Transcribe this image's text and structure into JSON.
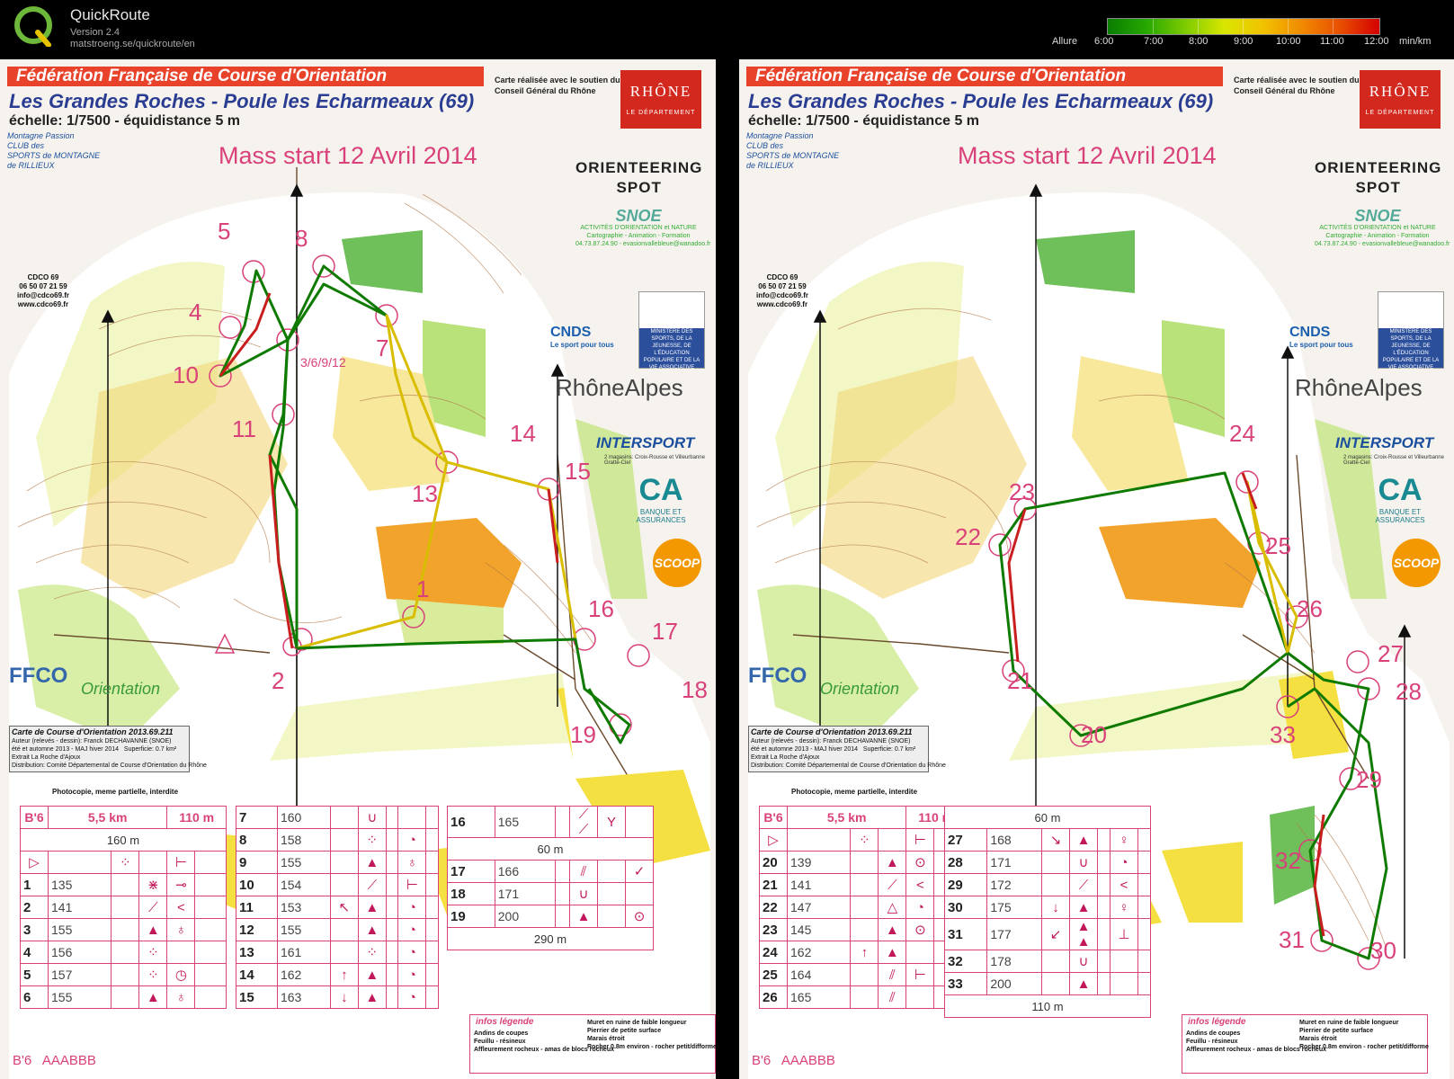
{
  "app": {
    "name": "QuickRoute",
    "version": "Version 2.4",
    "url": "matstroeng.se/quickroute/en"
  },
  "pace_scale": {
    "label": "Allure",
    "ticks": [
      "6:00",
      "7:00",
      "8:00",
      "9:00",
      "10:00",
      "11:00",
      "12:00"
    ],
    "unit": "min/km",
    "colors": [
      "#0a7d00",
      "#27a800",
      "#7ecb00",
      "#d8e600",
      "#f2c200",
      "#f08a00",
      "#e84e00",
      "#d40000"
    ]
  },
  "map": {
    "federation": "Fédération Française de Course d'Orientation",
    "title": "Les Grandes Roches - Poule les Echarmeaux (69)",
    "scale_line": "échelle: 1/7500  - équidistance 5 m",
    "event": "Mass start 12 Avril 2014",
    "support_note": "Carte réalisée avec le soutien du Conseil Général du Rhône",
    "rhone_logo": "RHÔNE",
    "rhone_sub": "LE DÉPARTEMENT",
    "club": "Montagne Passion\nCLUB des\nSPORTS de MONTAGNE\nde RILLIEUX",
    "cdco": "CDCO 69\n06 50 07 21 59\ninfo@cdco69.fr\nwww.cdco69.fr",
    "orienteering_spot": "ORIENTEERING\nSPOT",
    "snoe": "SNOE",
    "snoe_sub": "ACTIVITÉS D'ORIENTATION et NATURE\nCartographie - Animation - Formation\n04.73.87.24.90 - evasionvallebleue@wanadoo.fr",
    "cnds": "CNDS",
    "cnds_sub": "Le sport pour tous",
    "ministry": "MINISTÈRE DES SPORTS, DE LA JEUNESSE, DE L'ÉDUCATION POPULAIRE ET DE LA VIE ASSOCIATIVE",
    "rhone_alpes": "RhôneAlpes",
    "intersport": "INTERSPORT",
    "intersport_sub": "2 magasins: Croix-Rousse et Villeurbanne Gratte-Ciel",
    "ca_logo": "CA",
    "ca_sub": "BANQUE ET ASSURANCES",
    "scoop": "SCOOP",
    "ffco": "FFCO",
    "course_orientation": "Orientation",
    "card_title": "Carte de Course d'Orientation 2013.69.211",
    "card_lines": "Auteur (relevés - dessin): Franck DECHAVANNE (SNOE)\nété et automne 2013 - MAJ hiver 2014   Superficie: 0.7 km²\nExtrait La Roche d'Ajoux\nDistribution: Comité Départemental de Course d'Orientation du Rhône",
    "photocopy": "Photocopie, meme partielle, interdite"
  },
  "left_descriptions": {
    "header": [
      "B'6",
      "5,5 km",
      "110 m"
    ],
    "start_leg": "160 m",
    "col1": [
      {
        "n": "1",
        "c": "135",
        "s": "⋇",
        "d": "⊸"
      },
      {
        "n": "2",
        "c": "141",
        "s": "⟋",
        "d": "<"
      },
      {
        "n": "3",
        "c": "155",
        "s": "▲",
        "d": "♁"
      },
      {
        "n": "4",
        "c": "156",
        "s": "⁘",
        "d": ""
      },
      {
        "n": "5",
        "c": "157",
        "s": "⁘",
        "d": "◷"
      },
      {
        "n": "6",
        "c": "155",
        "s": "▲",
        "d": "♁"
      }
    ],
    "col2": [
      {
        "n": "7",
        "c": "160",
        "a": "",
        "s": "∪",
        "d": ""
      },
      {
        "n": "8",
        "c": "158",
        "a": "",
        "s": "⁘",
        "d": "◔"
      },
      {
        "n": "9",
        "c": "155",
        "a": "",
        "s": "▲",
        "d": "♁"
      },
      {
        "n": "10",
        "c": "154",
        "a": "",
        "s": "⟋",
        "d": "⊢"
      },
      {
        "n": "11",
        "c": "153",
        "a": "↖",
        "s": "▲",
        "d": "◔"
      },
      {
        "n": "12",
        "c": "155",
        "a": "",
        "s": "▲",
        "d": "◔"
      },
      {
        "n": "13",
        "c": "161",
        "a": "",
        "s": "⁘",
        "d": "◔"
      },
      {
        "n": "14",
        "c": "162",
        "a": "↑",
        "s": "▲",
        "d": "◔"
      },
      {
        "n": "15",
        "c": "163",
        "a": "↓",
        "s": "▲",
        "d": "◔"
      }
    ],
    "col3": [
      {
        "n": "16",
        "c": "165",
        "s": "⟋ ⟋",
        "d": "Y"
      },
      {
        "n": "17",
        "c": "166",
        "s": "⫽",
        "d": "✓"
      },
      {
        "n": "18",
        "c": "171",
        "s": "∪",
        "d": ""
      },
      {
        "n": "19",
        "c": "200",
        "s": "▲",
        "d": "⊙"
      }
    ],
    "mid_leg": "60 m",
    "finish_leg": "290 m"
  },
  "right_descriptions": {
    "header": [
      "B'6",
      "5,5 km",
      "110 m"
    ],
    "col1": [
      {
        "n": "20",
        "c": "139",
        "s": "▲",
        "d": "⊙"
      },
      {
        "n": "21",
        "c": "141",
        "s": "⟋",
        "d": "<"
      },
      {
        "n": "22",
        "c": "147",
        "s": "△",
        "d": "◔"
      },
      {
        "n": "23",
        "c": "145",
        "s": "▲",
        "d": "⊙"
      },
      {
        "n": "24",
        "c": "162",
        "a": "↑",
        "s": "▲",
        "d": ""
      },
      {
        "n": "25",
        "c": "164",
        "s": "⫽",
        "d": "⊢"
      },
      {
        "n": "26",
        "c": "165",
        "s": "⫽",
        "d": ""
      }
    ],
    "col2": [
      {
        "n": "27",
        "c": "168",
        "a": "↘",
        "s": "▲",
        "d": "♀"
      },
      {
        "n": "28",
        "c": "171",
        "s": "∪",
        "d": "◔"
      },
      {
        "n": "29",
        "c": "172",
        "s": "⟋",
        "d": "<"
      },
      {
        "n": "30",
        "c": "175",
        "a": "↓",
        "s": "▲",
        "d": "♀"
      },
      {
        "n": "31",
        "c": "177",
        "a": "↙",
        "s": "▲ ▲",
        "d": "⊥"
      },
      {
        "n": "32",
        "c": "178",
        "s": "∪",
        "d": ""
      },
      {
        "n": "33",
        "c": "200",
        "s": "▲",
        "d": ""
      }
    ],
    "top_leg": "60 m",
    "finish_leg": "110 m"
  },
  "footer": {
    "code": "B'6",
    "letters": "AAABBB"
  },
  "legend": {
    "title": "infos légende",
    "left": "Andins de coupes\nFeuillu - résineux\nAffleurement rocheux - amas de blocs rocheux",
    "right": "Muret en ruine de faible longueur\nPierrier de petite surface\nMarais étroit\nRocher 0.8m environ - rocher petit/difforme"
  },
  "left_control_labels": [
    "5",
    "8",
    "4",
    "7",
    "10",
    "3/6/9/12",
    "11",
    "14",
    "15",
    "13",
    "1",
    "16",
    "17",
    "2",
    "18",
    "19"
  ],
  "right_control_labels": [
    "24",
    "23",
    "22",
    "25",
    "26",
    "27",
    "21",
    "28",
    "20",
    "33",
    "29",
    "32",
    "31",
    "30"
  ]
}
